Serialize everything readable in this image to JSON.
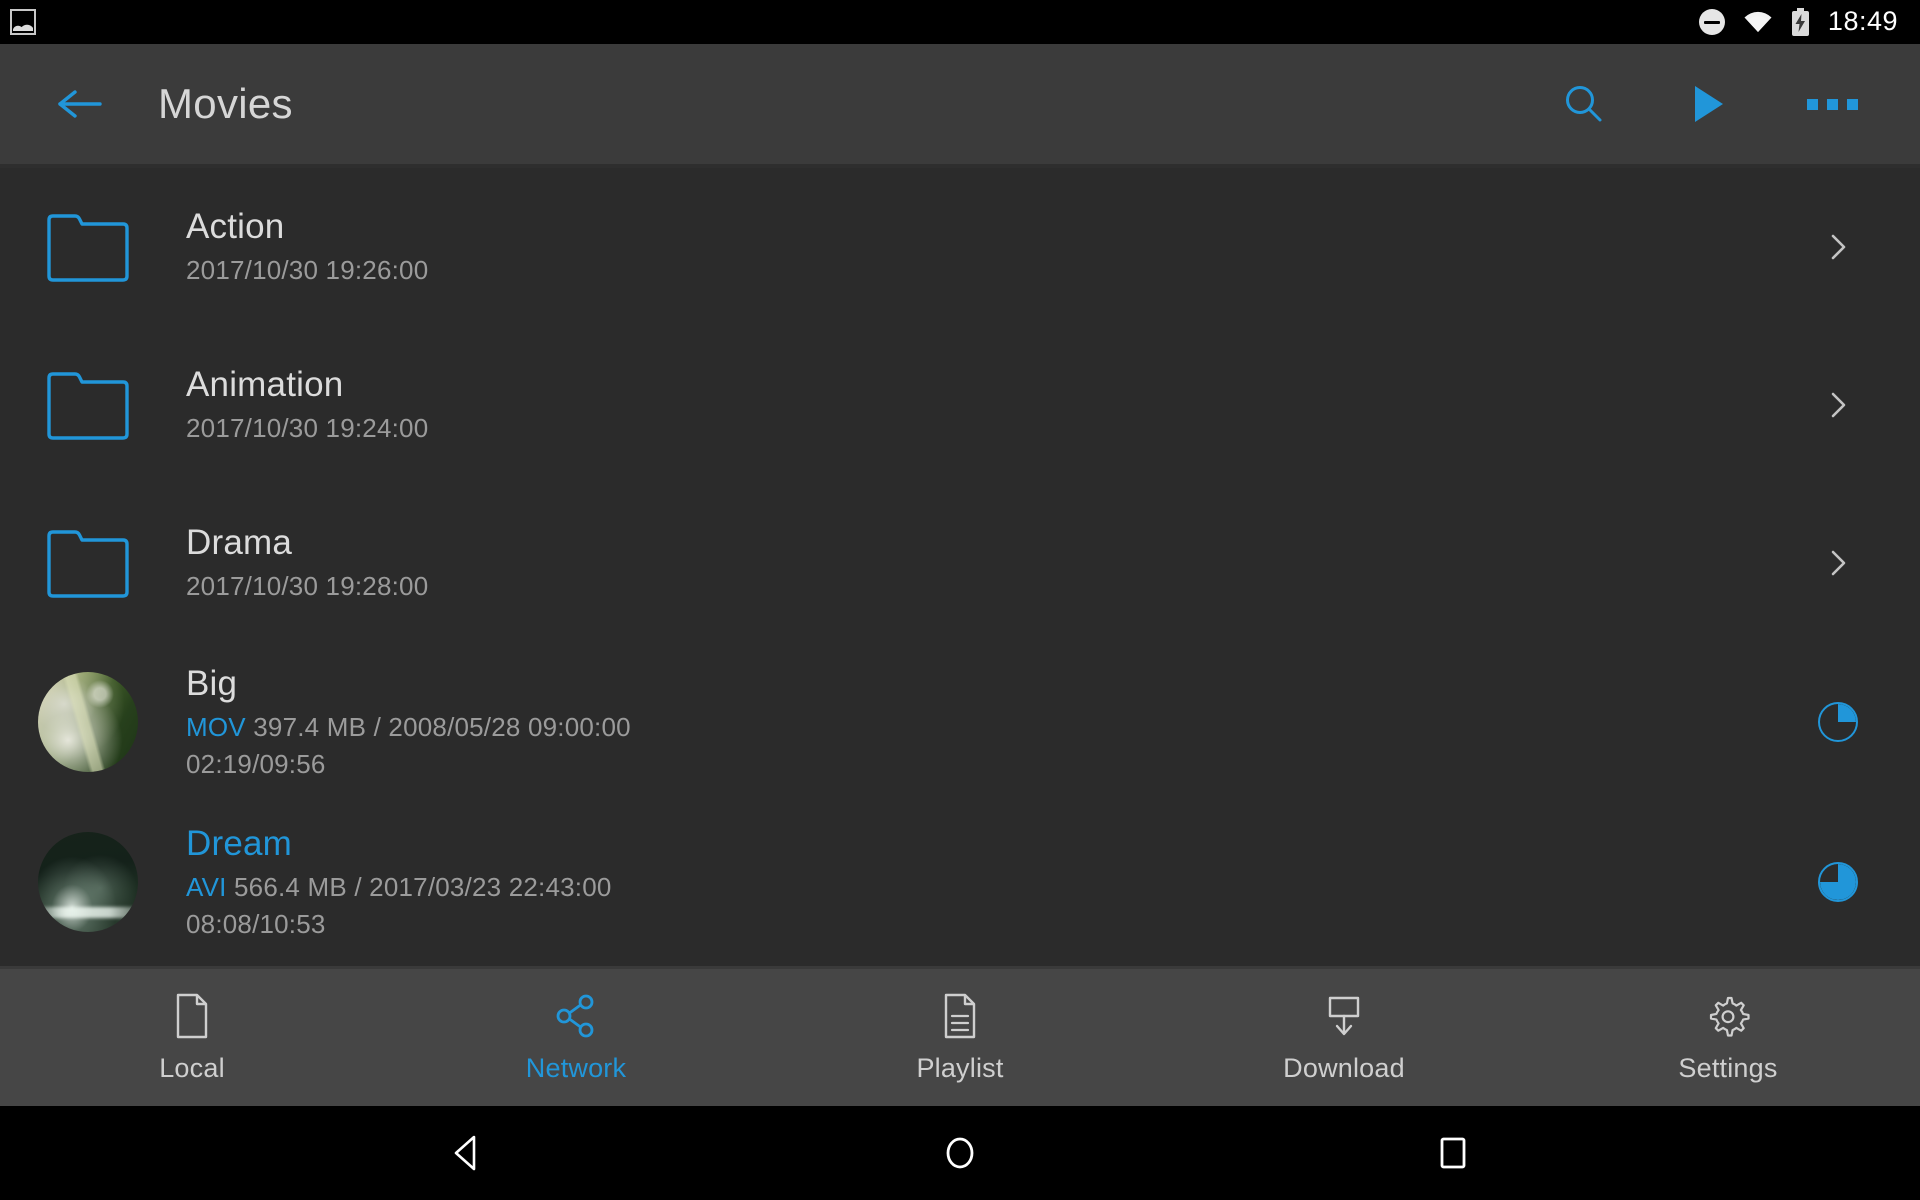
{
  "status_bar": {
    "notification_icon": "photo-icon",
    "dnd_icon": "do-not-disturb-icon",
    "wifi_icon": "wifi-icon",
    "battery_icon": "battery-charging-icon",
    "time": "18:49"
  },
  "app_bar": {
    "back_icon": "back-arrow-icon",
    "title": "Movies",
    "actions": [
      {
        "name": "search-icon",
        "label": "Search"
      },
      {
        "name": "play-icon",
        "label": "Play"
      },
      {
        "name": "overflow-menu-icon",
        "label": "More options"
      }
    ],
    "accent_color": "#2196d9"
  },
  "list": {
    "items": [
      {
        "type": "folder",
        "name": "Action",
        "date": "2017/10/30 19:26:00",
        "trailing": "chevron-right-icon"
      },
      {
        "type": "folder",
        "name": "Animation",
        "date": "2017/10/30 19:24:00",
        "trailing": "chevron-right-icon"
      },
      {
        "type": "folder",
        "name": "Drama",
        "date": "2017/10/30 19:28:00",
        "trailing": "chevron-right-icon"
      },
      {
        "type": "media",
        "name": "Big",
        "format": "MOV",
        "meta": "397.4 MB / 2008/05/28 09:00:00",
        "position": "02:19/09:56",
        "progress_percent": 25,
        "highlighted": false
      },
      {
        "type": "media",
        "name": "Dream",
        "format": "AVI",
        "meta": "566.4 MB / 2017/03/23 22:43:00",
        "position": "08:08/10:53",
        "progress_percent": 75,
        "highlighted": true
      }
    ]
  },
  "bottom_nav": {
    "items": [
      {
        "label": "Local",
        "icon": "file-icon",
        "active": false
      },
      {
        "label": "Network",
        "icon": "share-icon",
        "active": true
      },
      {
        "label": "Playlist",
        "icon": "playlist-icon",
        "active": false
      },
      {
        "label": "Download",
        "icon": "download-icon",
        "active": false
      },
      {
        "label": "Settings",
        "icon": "gear-icon",
        "active": false
      }
    ]
  },
  "system_nav": {
    "back": "android-back-icon",
    "home": "android-home-icon",
    "recents": "android-recents-icon"
  },
  "colors": {
    "accent": "#2196d9",
    "app_bar_bg": "#3b3b3b",
    "list_bg": "#2b2b2b",
    "bottom_nav_bg": "#464646",
    "primary_text": "#dcdcdc",
    "secondary_text": "#9b9b9b"
  }
}
